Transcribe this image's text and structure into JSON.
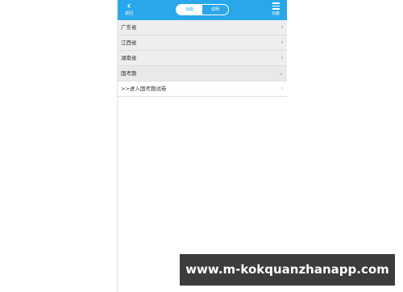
{
  "header": {
    "back_label": "返回",
    "menu_label": "功能",
    "tabs": [
      {
        "label": "功能",
        "active": true
      },
      {
        "label": "说明",
        "active": false
      }
    ],
    "accent_color": "#2aa7ea"
  },
  "list": {
    "items": [
      {
        "label": "广东省",
        "icon": "chevron-right-icon"
      },
      {
        "label": "江西省",
        "icon": "chevron-right-icon"
      },
      {
        "label": "湖南省",
        "icon": "chevron-right-icon"
      },
      {
        "label": "国考题",
        "icon": "chevron-down-icon"
      },
      {
        "label": ">>进入国考题试卷",
        "icon": "chevron-right-icon"
      }
    ]
  },
  "watermark": {
    "text": "www.m-kokquanzhanapp.com"
  }
}
